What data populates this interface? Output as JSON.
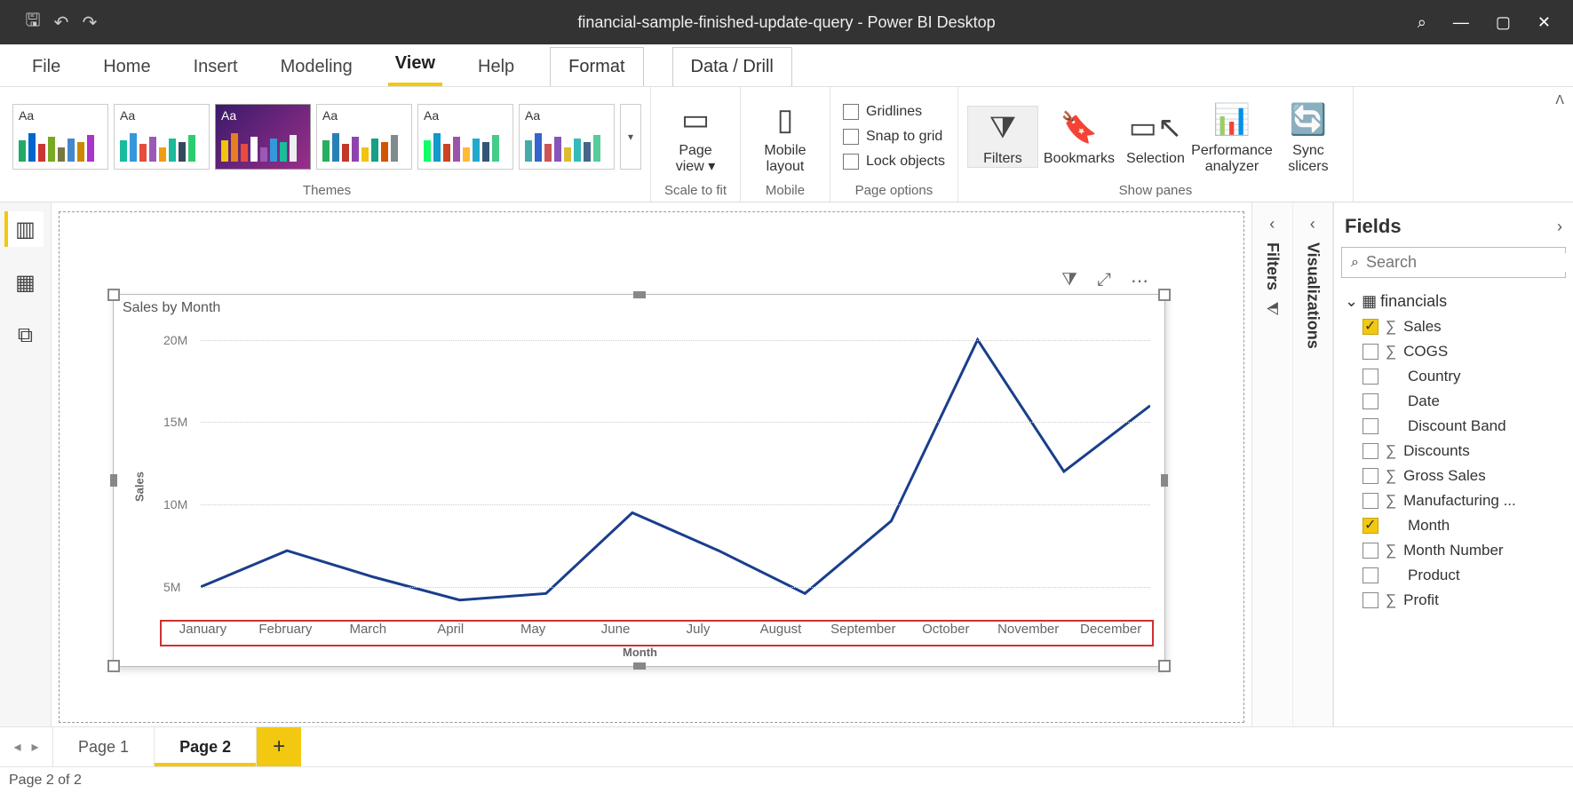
{
  "window": {
    "title": "financial-sample-finished-update-query - Power BI Desktop"
  },
  "ribbon_tabs": [
    "File",
    "Home",
    "Insert",
    "Modeling",
    "View",
    "Help",
    "Format",
    "Data / Drill"
  ],
  "ribbon": {
    "themes_label": "Themes",
    "scale_label": "Scale to fit",
    "mobile_label": "Mobile",
    "pageopts_label": "Page options",
    "showpanes_label": "Show panes",
    "page_view": "Page view",
    "mobile_layout": "Mobile layout",
    "gridlines": "Gridlines",
    "snap": "Snap to grid",
    "lock": "Lock objects",
    "filters": "Filters",
    "bookmarks": "Bookmarks",
    "selection": "Selection",
    "perf": "Performance analyzer",
    "sync": "Sync slicers"
  },
  "panes": {
    "filters": "Filters",
    "viz": "Visualizations",
    "fields": "Fields"
  },
  "fields": {
    "search_ph": "Search",
    "table": "financials",
    "items": [
      {
        "name": "Sales",
        "checked": true,
        "sigma": true
      },
      {
        "name": "COGS",
        "checked": false,
        "sigma": true
      },
      {
        "name": "Country",
        "checked": false,
        "sigma": false
      },
      {
        "name": "Date",
        "checked": false,
        "sigma": false
      },
      {
        "name": "Discount Band",
        "checked": false,
        "sigma": false
      },
      {
        "name": "Discounts",
        "checked": false,
        "sigma": true
      },
      {
        "name": "Gross Sales",
        "checked": false,
        "sigma": true
      },
      {
        "name": "Manufacturing ...",
        "checked": false,
        "sigma": true
      },
      {
        "name": "Month",
        "checked": true,
        "sigma": false
      },
      {
        "name": "Month Number",
        "checked": false,
        "sigma": true
      },
      {
        "name": "Product",
        "checked": false,
        "sigma": false
      },
      {
        "name": "Profit",
        "checked": false,
        "sigma": true
      }
    ]
  },
  "pages": {
    "p1": "Page 1",
    "p2": "Page 2"
  },
  "status": "Page 2 of 2",
  "chart_data": {
    "type": "line",
    "title": "Sales by Month",
    "xlabel": "Month",
    "ylabel": "Sales",
    "ylim": [
      3000000,
      21000000
    ],
    "yticks": [
      "5M",
      "10M",
      "15M",
      "20M"
    ],
    "categories": [
      "January",
      "February",
      "March",
      "April",
      "May",
      "June",
      "July",
      "August",
      "September",
      "October",
      "November",
      "December"
    ],
    "series": [
      {
        "name": "Sales",
        "values": [
          5000000,
          7200000,
          5600000,
          4200000,
          4600000,
          9500000,
          7200000,
          4600000,
          9000000,
          20000000,
          12000000,
          16000000
        ]
      }
    ]
  }
}
